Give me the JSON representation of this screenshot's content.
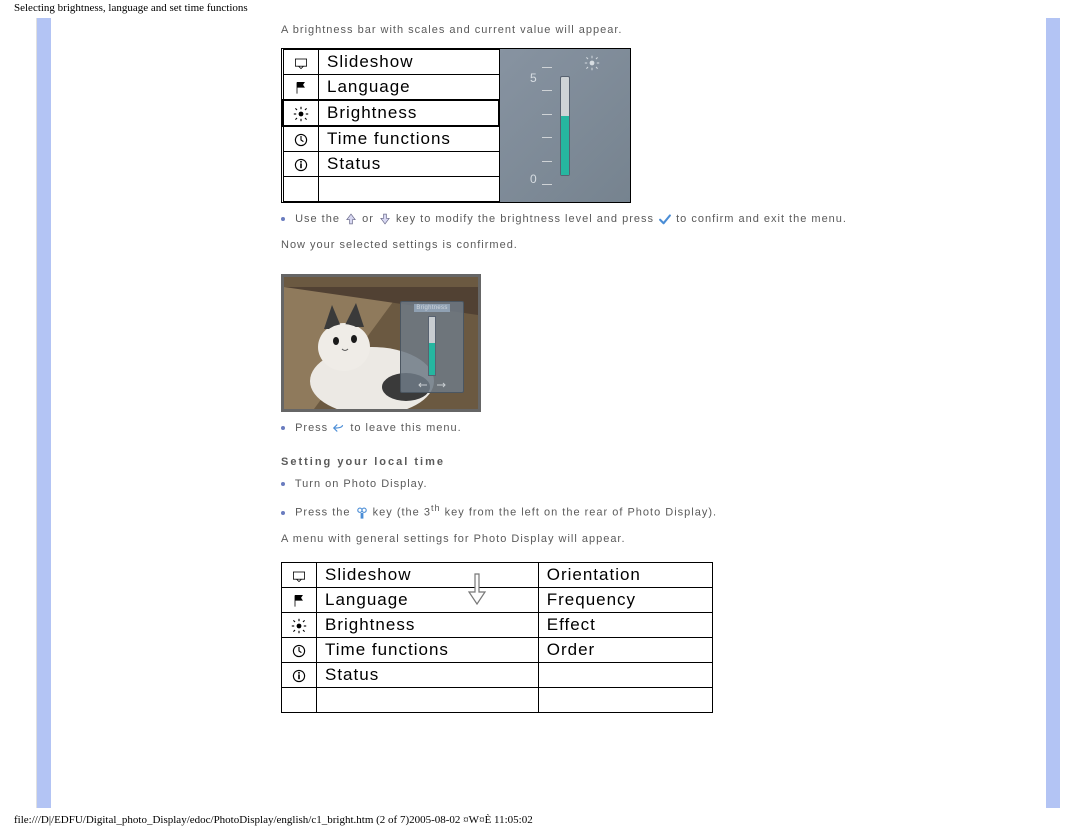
{
  "doc_title": "Selecting brightness, language and set time functions",
  "intro": "A brightness bar with scales and current value will appear.",
  "menu1": {
    "items": [
      "Slideshow",
      "Language",
      "Brightness",
      "Time functions",
      "Status"
    ],
    "selected_index": 2,
    "scale_top": "5",
    "scale_bottom": "0"
  },
  "bullet1": {
    "pre": "Use the ",
    "mid": " or ",
    "post1": " key to modify the brightness level and press ",
    "post2": " to confirm and exit the menu.",
    "confirm": "Now your selected settings is confirmed."
  },
  "overlay_title": "Brightness",
  "bullet2": {
    "pre": "Press ",
    "post": " to leave this menu."
  },
  "heading2": "Setting your local time",
  "bullet3": "Turn on Photo Display.",
  "bullet4": {
    "pre": "Press the ",
    "post1": " key (the 3",
    "sup": "th",
    "post2": " key from the left on the rear of Photo Display)."
  },
  "line_after": "A menu with general settings for Photo Display will appear.",
  "menu2": {
    "left": [
      "Slideshow",
      "Language",
      "Brightness",
      "Time functions",
      "Status"
    ],
    "right": [
      "Orientation",
      "Frequency",
      "Effect",
      "Order"
    ]
  },
  "footer": "file:///D|/EDFU/Digital_photo_Display/edoc/PhotoDisplay/english/c1_bright.htm (2 of 7)2005-08-02 ¤W¤È 11:05:02"
}
